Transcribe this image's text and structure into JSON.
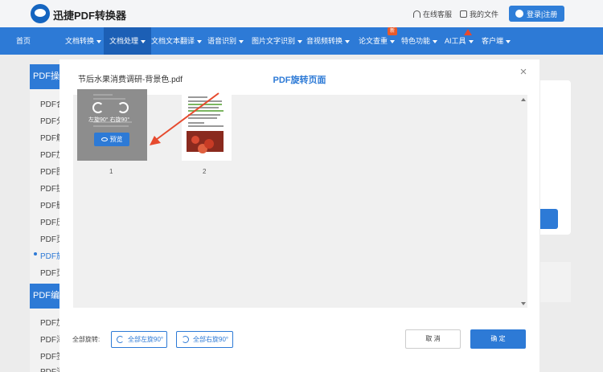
{
  "header": {
    "brand": "迅捷PDF转换器",
    "service": "在线客服",
    "my_files": "我的文件",
    "login": "登录|注册"
  },
  "nav": {
    "items": [
      {
        "label": "首页",
        "dropdown": false
      },
      {
        "label": "文档转换",
        "dropdown": true
      },
      {
        "label": "文档处理",
        "dropdown": true
      },
      {
        "label": "文档文本翻译",
        "dropdown": true
      },
      {
        "label": "语音识别",
        "dropdown": true
      },
      {
        "label": "图片文字识别",
        "dropdown": true
      },
      {
        "label": "音视频转换",
        "dropdown": true
      },
      {
        "label": "论文查重",
        "dropdown": true
      },
      {
        "label": "特色功能",
        "dropdown": true
      },
      {
        "label": "AI工具",
        "dropdown": true
      },
      {
        "label": "客户端",
        "dropdown": true
      }
    ],
    "new_badge": "新"
  },
  "sidebar": {
    "head1": "PDF操作",
    "items": [
      "PDF合并",
      "PDF分割",
      "PDF解密",
      "PDF加密",
      "PDF图片",
      "PDF提取",
      "PDF删除",
      "PDF压缩",
      "PDF页面",
      "PDF旋转",
      "PDF页码"
    ],
    "head2": "PDF编辑",
    "items2": [
      "PDF加水印",
      "PDF添加",
      "PDF签名",
      "PDF添加页码"
    ]
  },
  "modal": {
    "title": "PDF旋转页面",
    "close": "×",
    "file_name": "节后水果消费调研-背景色.pdf",
    "page1": {
      "number": "1",
      "rotate_text": "左旋90°  右旋90°",
      "preview": "预览"
    },
    "page2": {
      "number": "2"
    },
    "bottom": {
      "label": "全部旋转:",
      "rotate_left_all": "全部左旋90°",
      "rotate_right_all": "全部右旋90°",
      "cancel": "取 消",
      "confirm": "确 定"
    }
  },
  "colors": {
    "primary": "#2d7ad6",
    "annotation_arrow": "#e64a2e",
    "badge": "#e85a2b"
  }
}
